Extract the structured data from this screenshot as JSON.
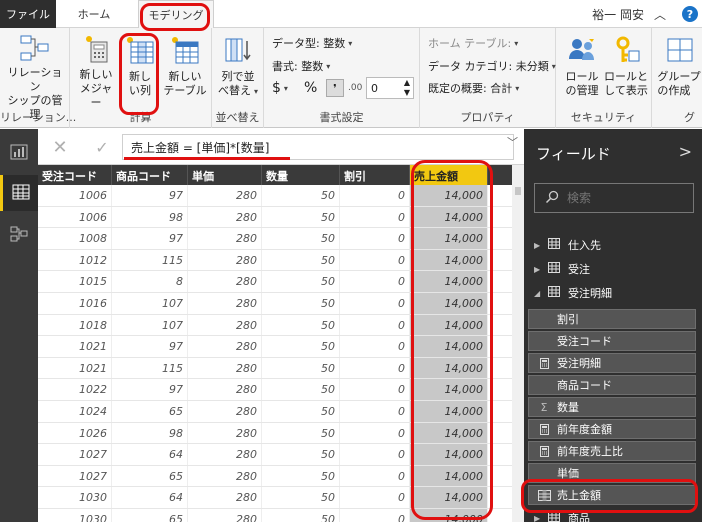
{
  "tabs": {
    "file": "ファイル",
    "home": "ホーム",
    "modeling": "モデリング"
  },
  "user": {
    "name": "裕一 岡安"
  },
  "ribbon": {
    "relations": {
      "button": "リレーション\nシップの管理",
      "group": "リレーション..."
    },
    "calc": {
      "measure": "新しい\nメジャー",
      "column": "新し\nい列",
      "table": "新しい\nテーブル",
      "group": "計算"
    },
    "sort": {
      "button": "列で並\nべ替え",
      "group": "並べ替え"
    },
    "format": {
      "datatype": "データ型: 整数",
      "format": "書式: 整数",
      "dollar": "$",
      "percent": "%",
      "comma": "❜",
      "decimal_value": "0",
      "group": "書式設定"
    },
    "props": {
      "home_table": "ホーム テーブル:",
      "category": "データ カテゴリ: 未分類",
      "summary": "既定の概要: 合計",
      "group": "プロパティ"
    },
    "security": {
      "manage": "ロール\nの管理",
      "view": "ロールと\nして表示",
      "group": "セキュリティ"
    },
    "groups": {
      "button": "グループ\nの作成",
      "group": "グ"
    }
  },
  "formula": {
    "text": "売上金額 = [単価]*[数量]"
  },
  "table": {
    "columns": [
      "受注コード",
      "商品コード",
      "単価",
      "数量",
      "割引",
      "売上金額"
    ],
    "rows": [
      [
        "1006",
        "97",
        "280",
        "50",
        "0",
        "14,000"
      ],
      [
        "1006",
        "98",
        "280",
        "50",
        "0",
        "14,000"
      ],
      [
        "1008",
        "97",
        "280",
        "50",
        "0",
        "14,000"
      ],
      [
        "1012",
        "115",
        "280",
        "50",
        "0",
        "14,000"
      ],
      [
        "1015",
        "8",
        "280",
        "50",
        "0",
        "14,000"
      ],
      [
        "1016",
        "107",
        "280",
        "50",
        "0",
        "14,000"
      ],
      [
        "1018",
        "107",
        "280",
        "50",
        "0",
        "14,000"
      ],
      [
        "1021",
        "97",
        "280",
        "50",
        "0",
        "14,000"
      ],
      [
        "1021",
        "115",
        "280",
        "50",
        "0",
        "14,000"
      ],
      [
        "1022",
        "97",
        "280",
        "50",
        "0",
        "14,000"
      ],
      [
        "1024",
        "65",
        "280",
        "50",
        "0",
        "14,000"
      ],
      [
        "1026",
        "98",
        "280",
        "50",
        "0",
        "14,000"
      ],
      [
        "1027",
        "64",
        "280",
        "50",
        "0",
        "14,000"
      ],
      [
        "1027",
        "65",
        "280",
        "50",
        "0",
        "14,000"
      ],
      [
        "1030",
        "64",
        "280",
        "50",
        "0",
        "14,000"
      ],
      [
        "1030",
        "65",
        "280",
        "50",
        "0",
        "14,000"
      ]
    ]
  },
  "fields_pane": {
    "title": "フィールド",
    "search_placeholder": "検索",
    "tables": [
      "仕入先",
      "受注",
      "受注明細"
    ],
    "fields": [
      {
        "label": "割引",
        "icon": "none"
      },
      {
        "label": "受注コード",
        "icon": "none"
      },
      {
        "label": "受注明細",
        "icon": "calculator-icon"
      },
      {
        "label": "商品コード",
        "icon": "none"
      },
      {
        "label": "数量",
        "icon": "sigma-icon"
      },
      {
        "label": "前年度金額",
        "icon": "calculator-icon"
      },
      {
        "label": "前年度売上比",
        "icon": "calculator-icon"
      },
      {
        "label": "単価",
        "icon": "none"
      },
      {
        "label": "売上金額",
        "icon": "calculated-column-icon"
      }
    ],
    "next_table": "商品"
  },
  "colors": {
    "accent": "#f2c811",
    "annotation": "#e01010",
    "dark": "#2f2f2f"
  }
}
